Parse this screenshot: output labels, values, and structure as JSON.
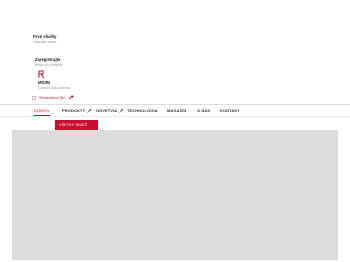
{
  "account": {
    "title": "Prvé stiahly",
    "subtitle": "Nahrajte súbor"
  },
  "login": {
    "title": "Zaregistrujte",
    "subtitle": "alebo sa prihláste"
  },
  "brand": {
    "name": "MIORI",
    "tagline": "Dobrou čast stránok"
  },
  "language": {
    "label": "Slovenčina SK"
  },
  "nav": {
    "items": [
      {
        "label": "DOMOV"
      },
      {
        "label": "PRODUKTY"
      },
      {
        "label": "ODVETVIA"
      },
      {
        "label": "TECHNOLÓGIA"
      },
      {
        "label": "MAGAZÍN"
      },
      {
        "label": "O NÁS"
      },
      {
        "label": "KONTAKT"
      }
    ]
  },
  "cta": {
    "label": "VŠETKY SNIEŽ"
  },
  "colors": {
    "accent": "#c8102e",
    "placeholder": "#dcdcdc"
  }
}
